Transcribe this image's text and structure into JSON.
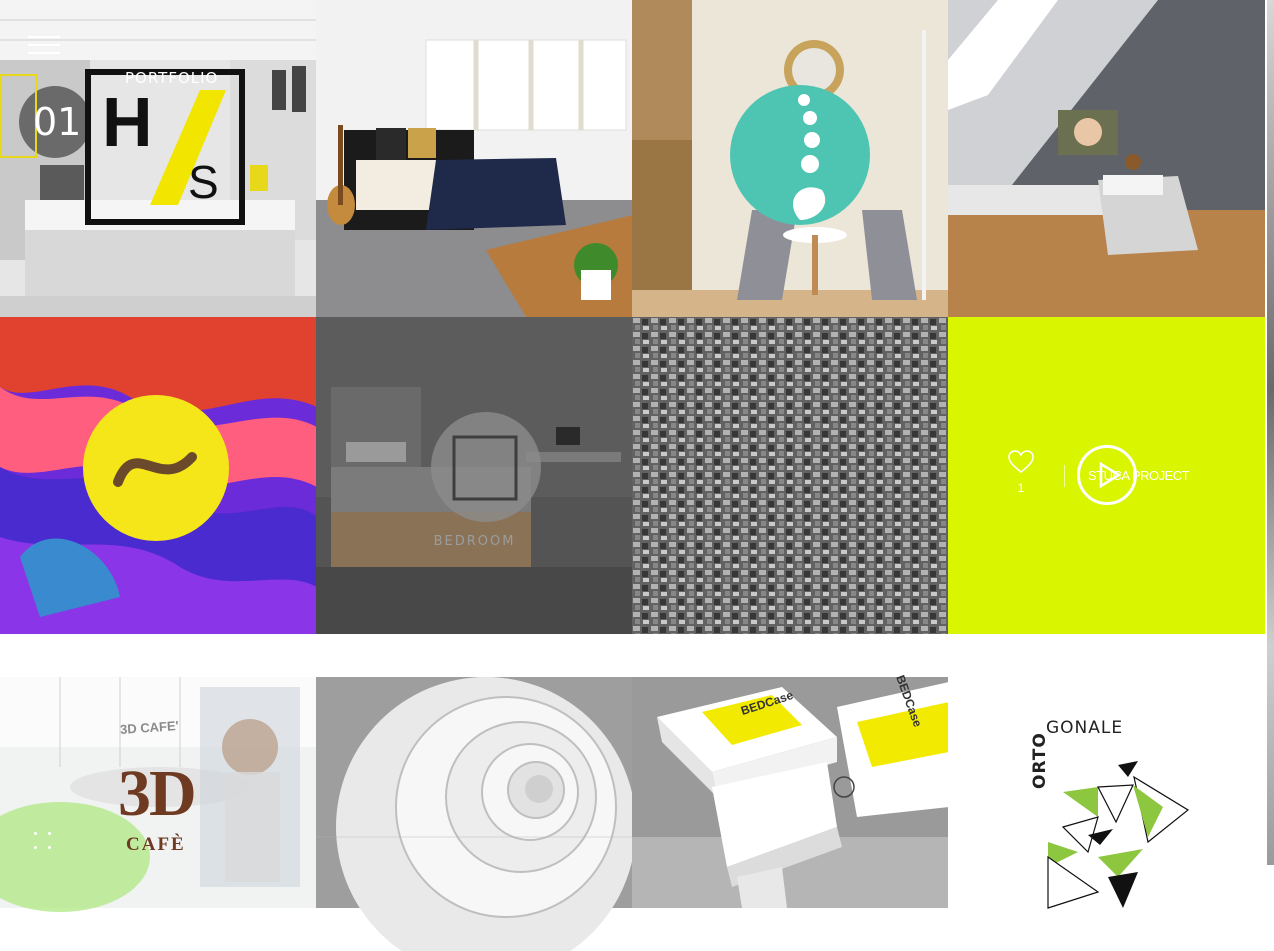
{
  "menu": {
    "icon": "hamburger-menu-icon"
  },
  "tiles": {
    "portfolio": {
      "label": "PORTFOLIO",
      "logo_number": "01",
      "logo_letter_h": "H",
      "logo_letter_s": "S"
    },
    "bedroom_dark": {
      "label": "BEDROOM"
    },
    "hover": {
      "like_count": "1",
      "project_title": "STUCA PROJECT",
      "like_icon": "heart-icon",
      "play_icon": "play-icon",
      "accent_color": "#d9f500"
    },
    "cafe": {
      "logo_big": "3D",
      "logo_small": "CAFÈ",
      "sign_text": "3D CAFE'"
    },
    "boxes": {
      "brand": "BEDCase"
    },
    "ortogonale": {
      "word_top": "GONALE",
      "word_side": "ORTO"
    }
  },
  "pagination": {
    "icon": "dots-icon"
  }
}
